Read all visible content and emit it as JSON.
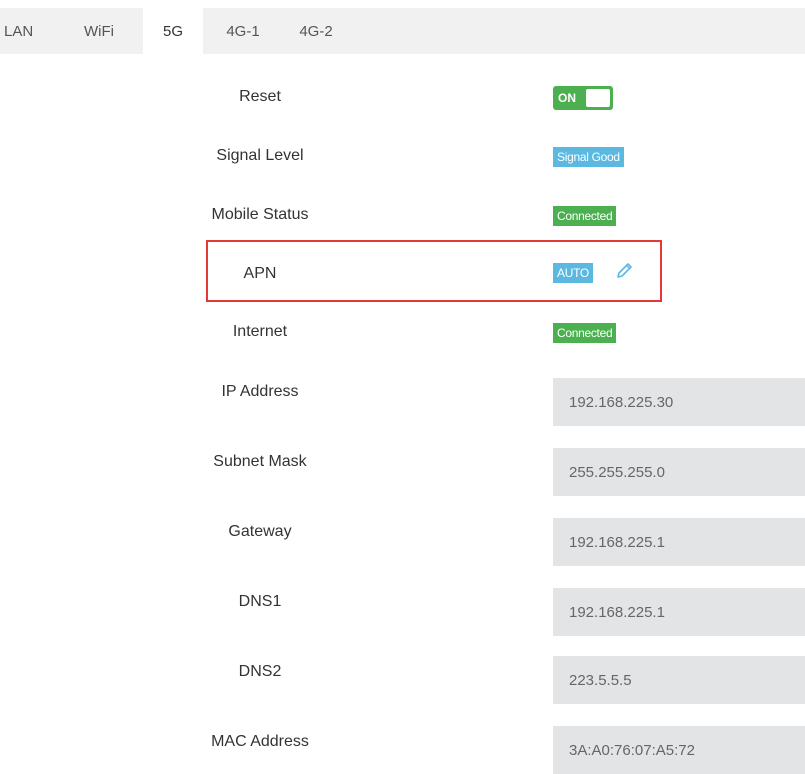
{
  "tabs": [
    {
      "label": "LAN"
    },
    {
      "label": "WiFi"
    },
    {
      "label": "5G",
      "active": true
    },
    {
      "label": "4G-1"
    },
    {
      "label": "4G-2"
    }
  ],
  "reset": {
    "label": "Reset",
    "toggle_text": "ON",
    "state": "on"
  },
  "signal_level": {
    "label": "Signal Level",
    "badge": "Signal Good"
  },
  "mobile_status": {
    "label": "Mobile Status",
    "badge": "Connected"
  },
  "apn": {
    "label": "APN",
    "badge": "AUTO",
    "edit_icon": "pencil-icon"
  },
  "internet": {
    "label": "Internet",
    "badge": "Connected"
  },
  "ip_address": {
    "label": "IP Address",
    "value": "192.168.225.30"
  },
  "subnet_mask": {
    "label": "Subnet Mask",
    "value": "255.255.255.0"
  },
  "gateway": {
    "label": "Gateway",
    "value": "192.168.225.1"
  },
  "dns1": {
    "label": "DNS1",
    "value": "192.168.225.1"
  },
  "dns2": {
    "label": "DNS2",
    "value": "223.5.5.5"
  },
  "mac_address": {
    "label": "MAC Address",
    "value": "3A:A0:76:07:A5:72"
  },
  "colors": {
    "toggle_on": "#4caf50",
    "badge_blue": "#5bb8e0",
    "badge_green": "#4caf50",
    "highlight": "#e53935",
    "field_bg": "#e2e4e6"
  }
}
